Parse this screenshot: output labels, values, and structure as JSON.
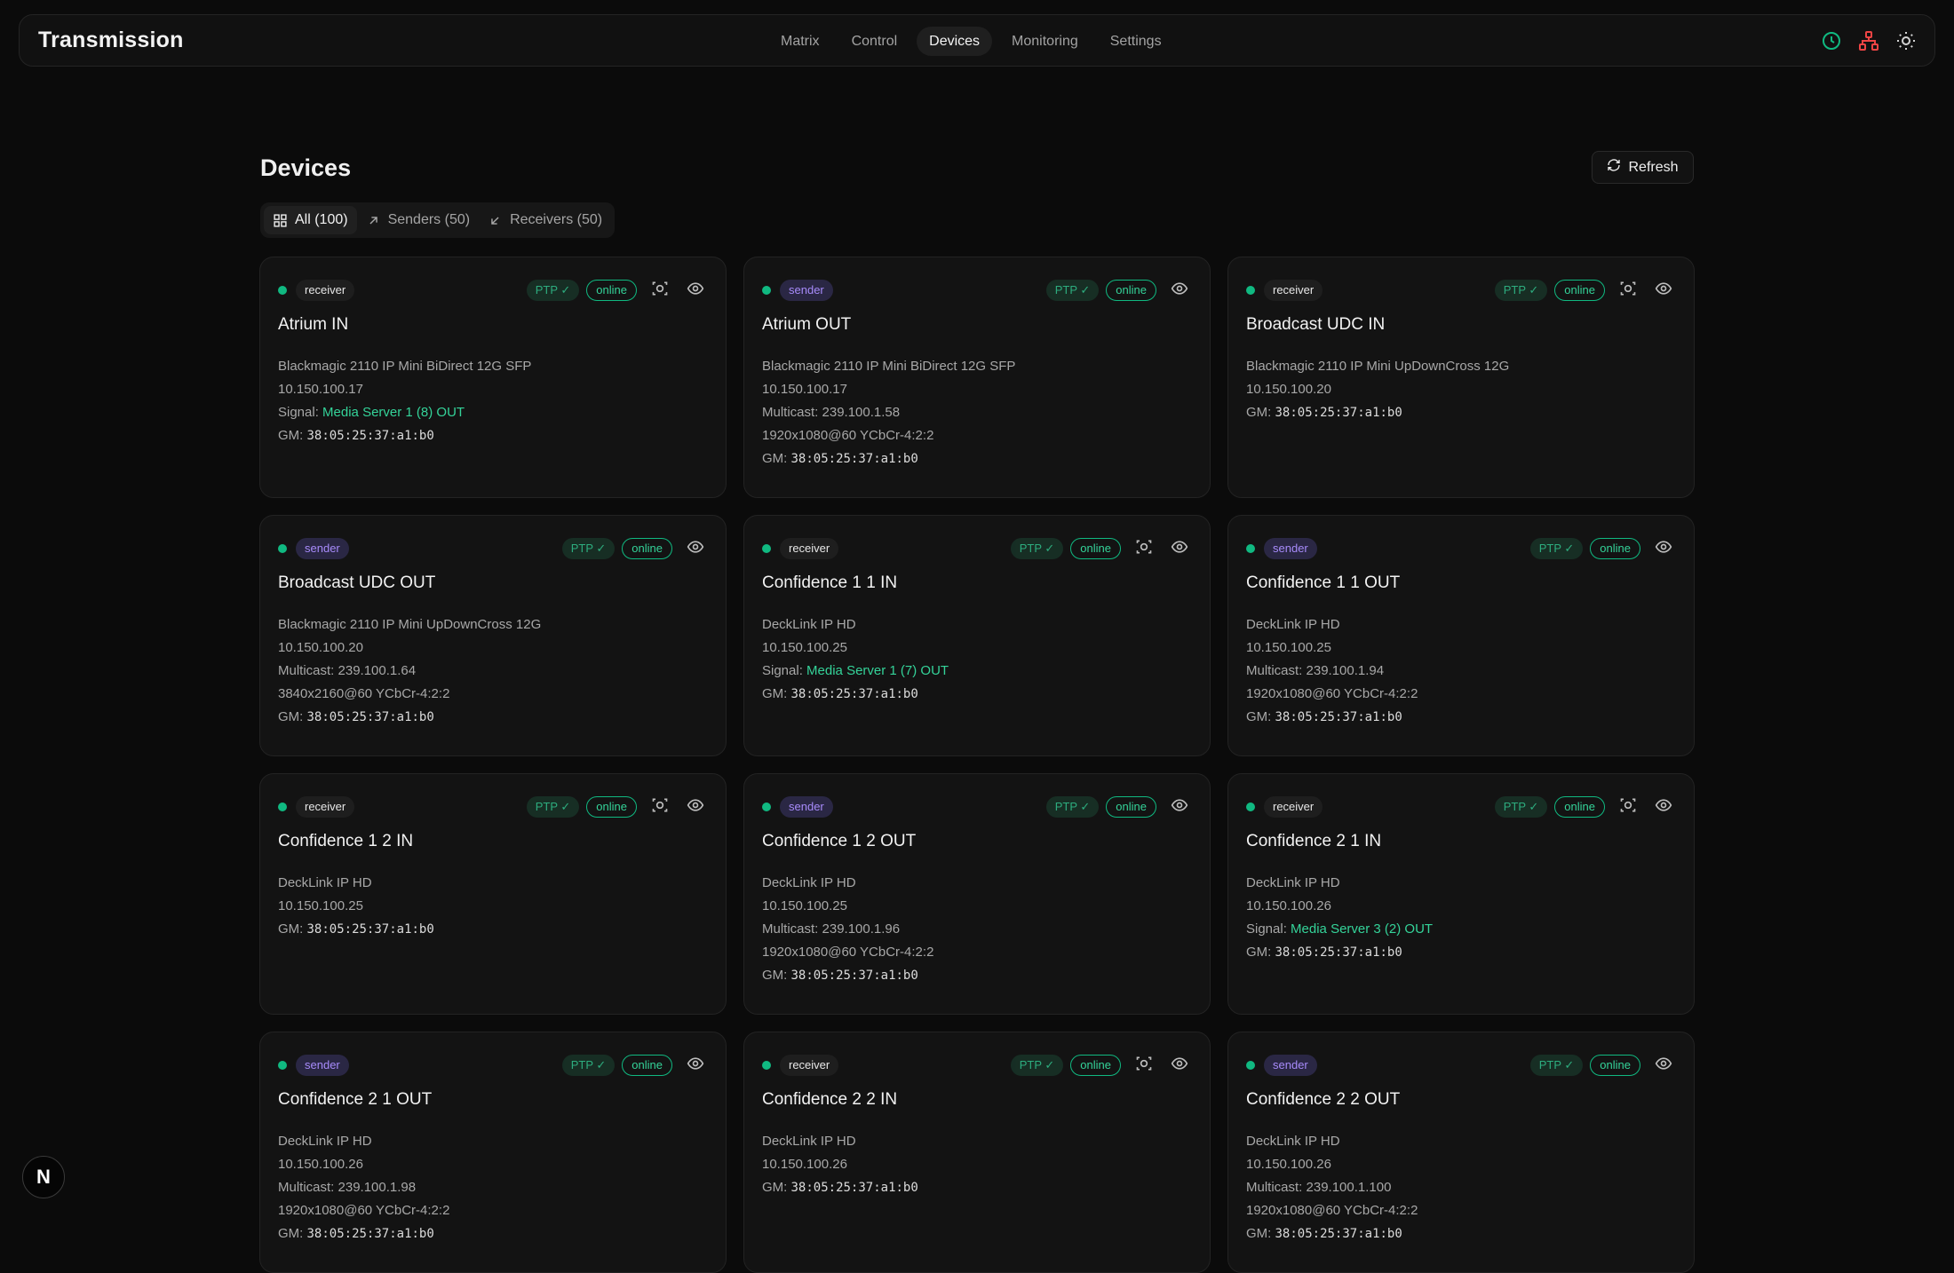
{
  "app": {
    "title": "Transmission"
  },
  "nav": [
    {
      "label": "Matrix"
    },
    {
      "label": "Control"
    },
    {
      "label": "Devices"
    },
    {
      "label": "Monitoring"
    },
    {
      "label": "Settings"
    }
  ],
  "nav_active": "Devices",
  "top_icons": [
    "clock-icon",
    "network-tree-icon",
    "sun-icon"
  ],
  "page": {
    "title": "Devices",
    "refresh_label": "Refresh"
  },
  "filters": [
    {
      "label": "All (100)",
      "icon": "grid-icon"
    },
    {
      "label": "Senders (50)",
      "icon": "arrow-up-right-icon"
    },
    {
      "label": "Receivers (50)",
      "icon": "arrow-down-left-icon"
    }
  ],
  "colors": {
    "accent_green": "#10b981",
    "sender_purple": "#a78bfa",
    "background": "#0b0b0b"
  },
  "devices": [
    {
      "kind": "receiver",
      "ptp": "PTP ✓",
      "status": "online",
      "name": "Atrium IN",
      "model": "Blackmagic 2110 IP Mini BiDirect 12G SFP",
      "ip": "10.150.100.17",
      "signal_label": "Signal: ",
      "signal": "Media Server 1 (8) OUT",
      "gm_label": "GM: ",
      "gm": "38:05:25:37:a1:b0"
    },
    {
      "kind": "sender",
      "ptp": "PTP ✓",
      "status": "online",
      "name": "Atrium OUT",
      "model": "Blackmagic 2110 IP Mini BiDirect 12G SFP",
      "ip": "10.150.100.17",
      "multicast": "Multicast: 239.100.1.58",
      "format": "1920x1080@60 YCbCr-4:2:2",
      "gm_label": "GM: ",
      "gm": "38:05:25:37:a1:b0"
    },
    {
      "kind": "receiver",
      "ptp": "PTP ✓",
      "status": "online",
      "name": "Broadcast UDC IN",
      "model": "Blackmagic 2110 IP Mini UpDownCross 12G",
      "ip": "10.150.100.20",
      "gm_label": "GM: ",
      "gm": "38:05:25:37:a1:b0"
    },
    {
      "kind": "sender",
      "ptp": "PTP ✓",
      "status": "online",
      "name": "Broadcast UDC OUT",
      "model": "Blackmagic 2110 IP Mini UpDownCross 12G",
      "ip": "10.150.100.20",
      "multicast": "Multicast: 239.100.1.64",
      "format": "3840x2160@60 YCbCr-4:2:2",
      "gm_label": "GM: ",
      "gm": "38:05:25:37:a1:b0"
    },
    {
      "kind": "receiver",
      "ptp": "PTP ✓",
      "status": "online",
      "name": "Confidence 1 1 IN",
      "model": "DeckLink IP HD",
      "ip": "10.150.100.25",
      "signal_label": "Signal: ",
      "signal": "Media Server 1 (7) OUT",
      "gm_label": "GM: ",
      "gm": "38:05:25:37:a1:b0"
    },
    {
      "kind": "sender",
      "ptp": "PTP ✓",
      "status": "online",
      "name": "Confidence 1 1 OUT",
      "model": "DeckLink IP HD",
      "ip": "10.150.100.25",
      "multicast": "Multicast: 239.100.1.94",
      "format": "1920x1080@60 YCbCr-4:2:2",
      "gm_label": "GM: ",
      "gm": "38:05:25:37:a1:b0"
    },
    {
      "kind": "receiver",
      "ptp": "PTP ✓",
      "status": "online",
      "name": "Confidence 1 2 IN",
      "model": "DeckLink IP HD",
      "ip": "10.150.100.25",
      "gm_label": "GM: ",
      "gm": "38:05:25:37:a1:b0"
    },
    {
      "kind": "sender",
      "ptp": "PTP ✓",
      "status": "online",
      "name": "Confidence 1 2 OUT",
      "model": "DeckLink IP HD",
      "ip": "10.150.100.25",
      "multicast": "Multicast: 239.100.1.96",
      "format": "1920x1080@60 YCbCr-4:2:2",
      "gm_label": "GM: ",
      "gm": "38:05:25:37:a1:b0"
    },
    {
      "kind": "receiver",
      "ptp": "PTP ✓",
      "status": "online",
      "name": "Confidence 2 1 IN",
      "model": "DeckLink IP HD",
      "ip": "10.150.100.26",
      "signal_label": "Signal: ",
      "signal": "Media Server 3 (2) OUT",
      "gm_label": "GM: ",
      "gm": "38:05:25:37:a1:b0"
    },
    {
      "kind": "sender",
      "ptp": "PTP ✓",
      "status": "online",
      "name": "Confidence 2 1 OUT",
      "model": "DeckLink IP HD",
      "ip": "10.150.100.26",
      "multicast": "Multicast: 239.100.1.98",
      "format": "1920x1080@60 YCbCr-4:2:2",
      "gm_label": "GM: ",
      "gm": "38:05:25:37:a1:b0"
    },
    {
      "kind": "receiver",
      "ptp": "PTP ✓",
      "status": "online",
      "name": "Confidence 2 2 IN",
      "model": "DeckLink IP HD",
      "ip": "10.150.100.26",
      "gm_label": "GM: ",
      "gm": "38:05:25:37:a1:b0"
    },
    {
      "kind": "sender",
      "ptp": "PTP ✓",
      "status": "online",
      "name": "Confidence 2 2 OUT",
      "model": "DeckLink IP HD",
      "ip": "10.150.100.26",
      "multicast": "Multicast: 239.100.1.100",
      "format": "1920x1080@60 YCbCr-4:2:2",
      "gm_label": "GM: ",
      "gm": "38:05:25:37:a1:b0"
    }
  ],
  "dev_badge": "N"
}
